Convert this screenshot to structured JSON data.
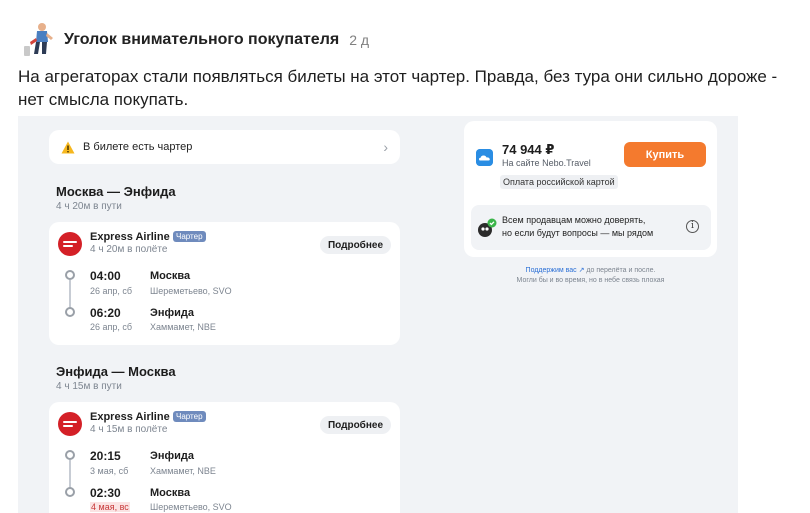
{
  "post": {
    "author": "Уголок внимательного покупателя",
    "age": "2 д",
    "text": "На агрегаторах стали появляться билеты на этот чартер. Правда, без тура они сильно дороже - нет смысла покупать."
  },
  "banner": {
    "text": "В билете есть чартер",
    "icon": "warning-icon"
  },
  "legs": [
    {
      "title": "Москва — Энфида",
      "duration": "4 ч 20м в пути",
      "airline": "Express Airline",
      "badge": "Чартер",
      "flight_duration": "4 ч 20м в полёте",
      "details_label": "Подробнее",
      "depart": {
        "time": "04:00",
        "date": "26 апр, сб",
        "city": "Москва",
        "airport": "Шереметьево, SVO"
      },
      "arrive": {
        "time": "06:20",
        "date": "26 апр, сб",
        "city": "Энфида",
        "airport": "Хаммамет, NBE"
      }
    },
    {
      "title": "Энфида — Москва",
      "duration": "4 ч 15м в пути",
      "airline": "Express Airline",
      "badge": "Чартер",
      "flight_duration": "4 ч 15м в полёте",
      "details_label": "Подробнее",
      "depart": {
        "time": "20:15",
        "date": "3 мая, сб",
        "city": "Энфида",
        "airport": "Хаммамет, NBE"
      },
      "arrive": {
        "time": "02:30",
        "date": "4 мая, вс",
        "city": "Москва",
        "airport": "Шереметьево, SVO"
      }
    }
  ],
  "offer": {
    "price": "74 944 ₽",
    "seller": "На сайте Nebo.Travel",
    "payment": "Оплата российской картой",
    "buy_label": "Купить",
    "trust_line1": "Всем продавцам можно доверять,",
    "trust_line2": "но если будут вопросы — мы рядом",
    "info_glyph": "i"
  },
  "support": {
    "link": "Поддержим вас ↗",
    "line1_rest": " до перелёта и после.",
    "line2": "Могли бы и во время, но в небе связь плохая"
  },
  "colors": {
    "buy_button": "#f47a2e",
    "charter_badge": "#6f8bbd",
    "airline_logo": "#d42027",
    "date_alert": "#c83a3a"
  }
}
